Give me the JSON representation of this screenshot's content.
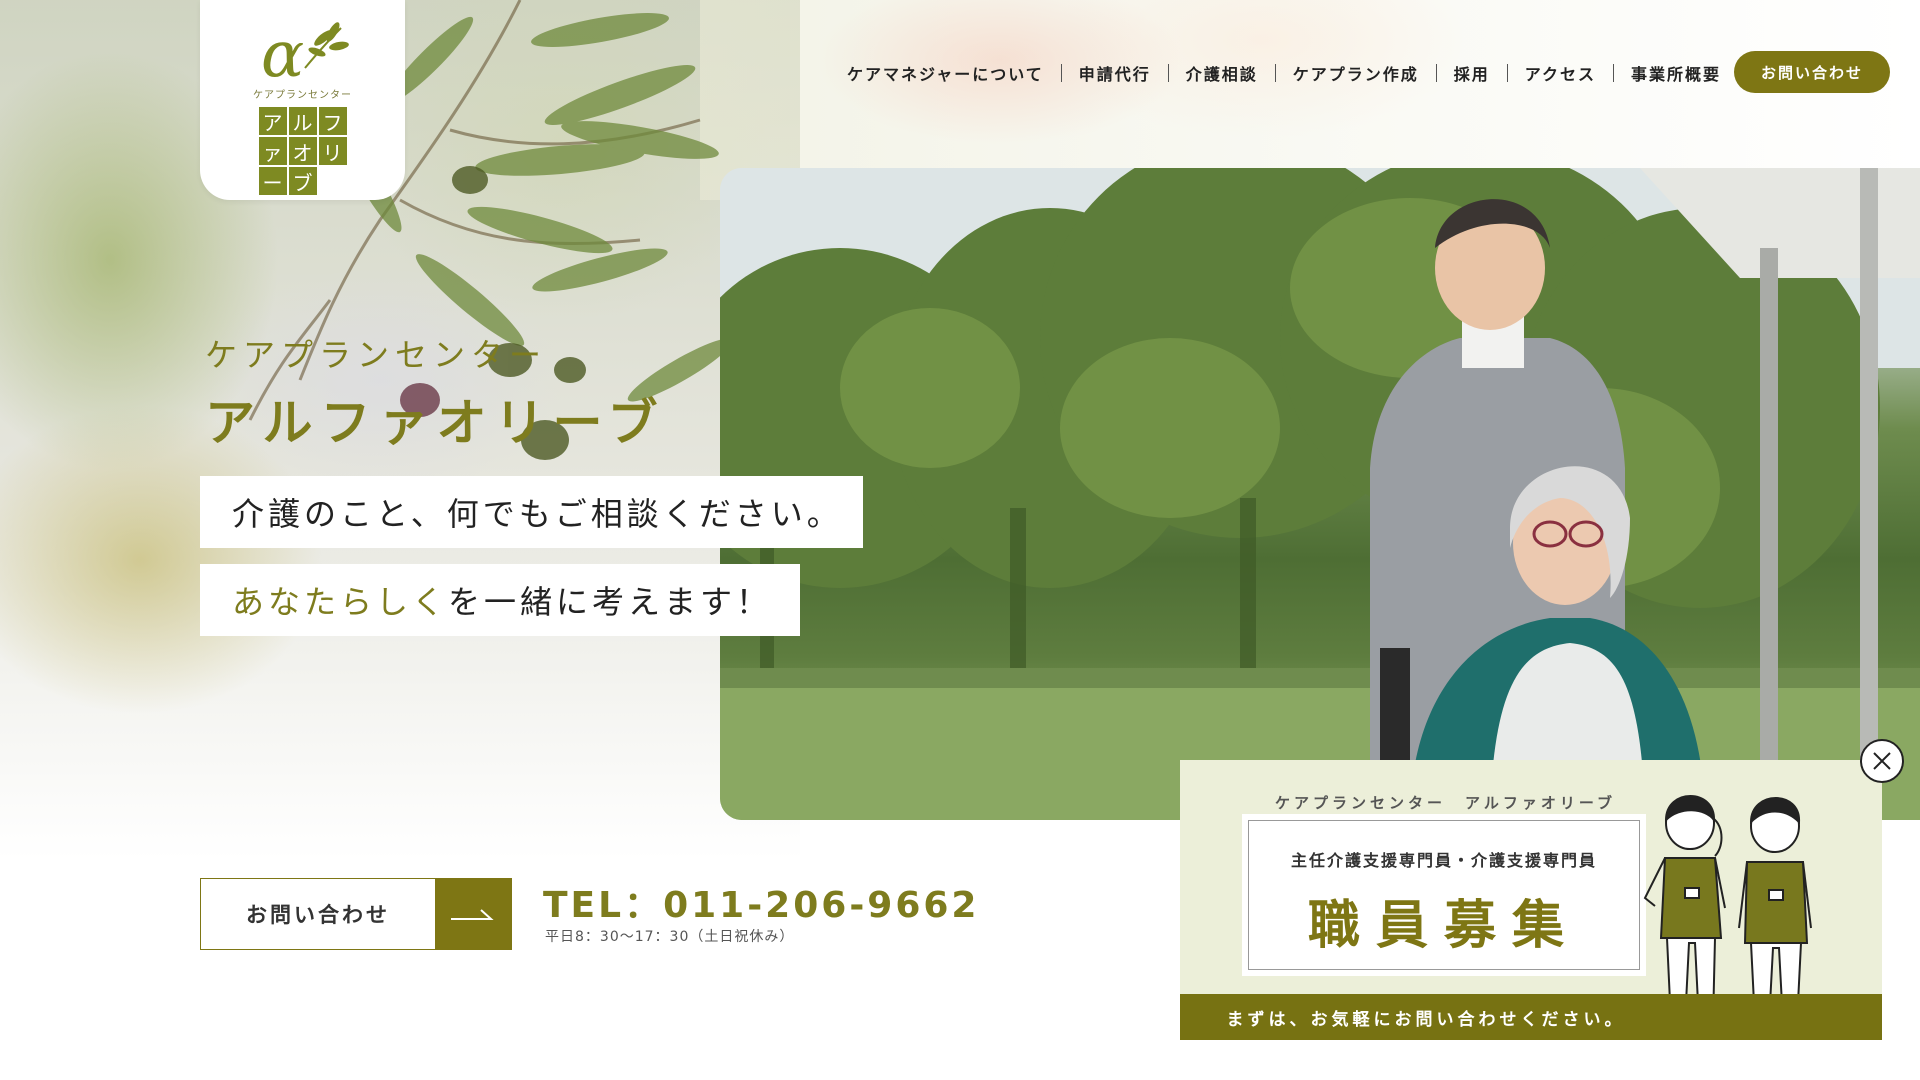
{
  "logo": {
    "subtitle": "ケアプランセンター",
    "chars": [
      "ア",
      "ル",
      "フ",
      "ァ",
      "オ",
      "リ",
      "ー",
      "ブ"
    ]
  },
  "nav": {
    "items": [
      {
        "label": "ケアマネジャーについて"
      },
      {
        "label": "申請代行"
      },
      {
        "label": "介護相談"
      },
      {
        "label": "ケアプラン作成"
      },
      {
        "label": "採用"
      },
      {
        "label": "アクセス"
      },
      {
        "label": "事業所概要"
      }
    ],
    "contact_label": "お問い合わせ"
  },
  "hero": {
    "kana": "ケアプランセンター",
    "name": "アルファオリーブ",
    "catch_1": "介護のこと、何でもご相談ください。",
    "catch_2_highlight": "あなたらしく",
    "catch_2_rest": "を一緒に考えます！"
  },
  "contact": {
    "button_label": "お問い合わせ",
    "tel": "TEL：011-206-9662",
    "hours": "平日8：30〜17：30（土日祝休み）"
  },
  "recruit": {
    "company": "ケアプランセンター　アルファオリーブ",
    "positions": "主任介護支援専門員・介護支援専門員",
    "headline": "職員募集",
    "footer": "まずは、お気軽にお問い合わせください。"
  },
  "icons": {
    "logo": "alpha-olive-logo-icon",
    "cta_arrow": "arrow-right-icon",
    "close": "close-icon"
  },
  "colors": {
    "brand_olive": "#7e7614",
    "brand_text": "#7e7c1e",
    "popup_bg": "#ecefd9"
  }
}
